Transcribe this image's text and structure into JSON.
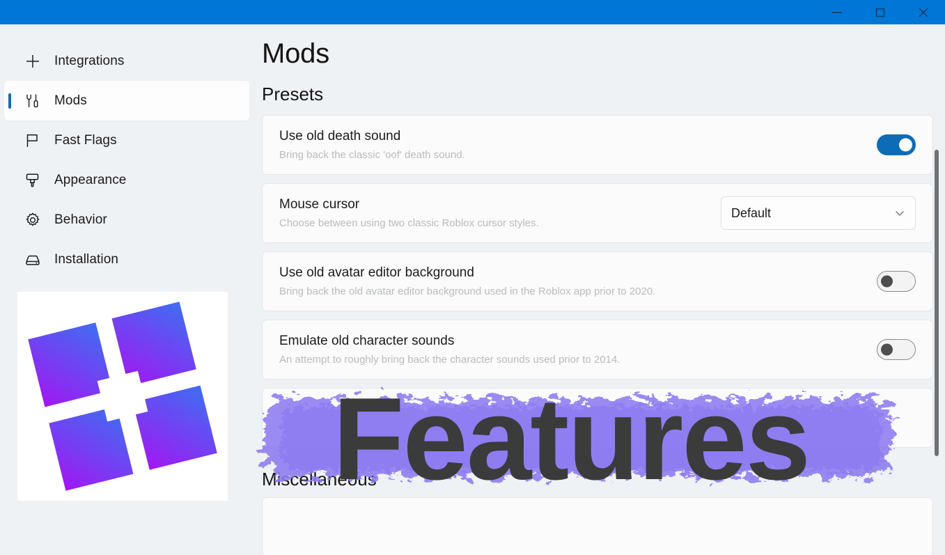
{
  "window": {
    "titlebar_color": "#0077d6",
    "controls": [
      {
        "name": "minimize",
        "glyph": "minimize-icon"
      },
      {
        "name": "maximize",
        "glyph": "maximize-icon"
      },
      {
        "name": "close",
        "glyph": "close-icon"
      }
    ]
  },
  "sidebar": {
    "items": [
      {
        "label": "Integrations",
        "icon": "plus-icon",
        "selected": false
      },
      {
        "label": "Mods",
        "icon": "tools-icon",
        "selected": true
      },
      {
        "label": "Fast Flags",
        "icon": "flag-icon",
        "selected": false
      },
      {
        "label": "Appearance",
        "icon": "paintbrush-icon",
        "selected": false
      },
      {
        "label": "Behavior",
        "icon": "gear-icon",
        "selected": false
      },
      {
        "label": "Installation",
        "icon": "hard-drive-icon",
        "selected": false
      }
    ],
    "logo_alt": "bloxstrap-logo",
    "accent_color": "#0d6cb5"
  },
  "main": {
    "page_title": "Mods",
    "sections": [
      {
        "heading": "Presets",
        "cards": [
          {
            "title": "Use old death sound",
            "subtitle": "Bring back the classic 'oof' death sound.",
            "control": "toggle",
            "value": "on"
          },
          {
            "title": "Mouse cursor",
            "subtitle": "Choose between using two classic Roblox cursor styles.",
            "control": "dropdown",
            "value": "Default"
          },
          {
            "title": "Use old avatar editor background",
            "subtitle": "Bring back the old avatar editor background used in the Roblox app prior to 2020.",
            "control": "toggle",
            "value": "off"
          },
          {
            "title": "Emulate old character sounds",
            "subtitle": "An attempt to roughly bring back the character sounds used prior to 2014.",
            "control": "toggle",
            "value": "off"
          },
          {
            "title": "",
            "subtitle": "",
            "control": "none",
            "value": ""
          }
        ]
      },
      {
        "heading": "Miscellaneous",
        "cards": [
          {
            "title": "",
            "subtitle": "",
            "control": "none",
            "value": ""
          }
        ]
      }
    ]
  },
  "watermark": {
    "text": "Features",
    "brush_color": "#8c7bf0",
    "text_color": "#3b3b3b"
  },
  "scrollbar": {
    "thumb_color": "#6e7176"
  }
}
